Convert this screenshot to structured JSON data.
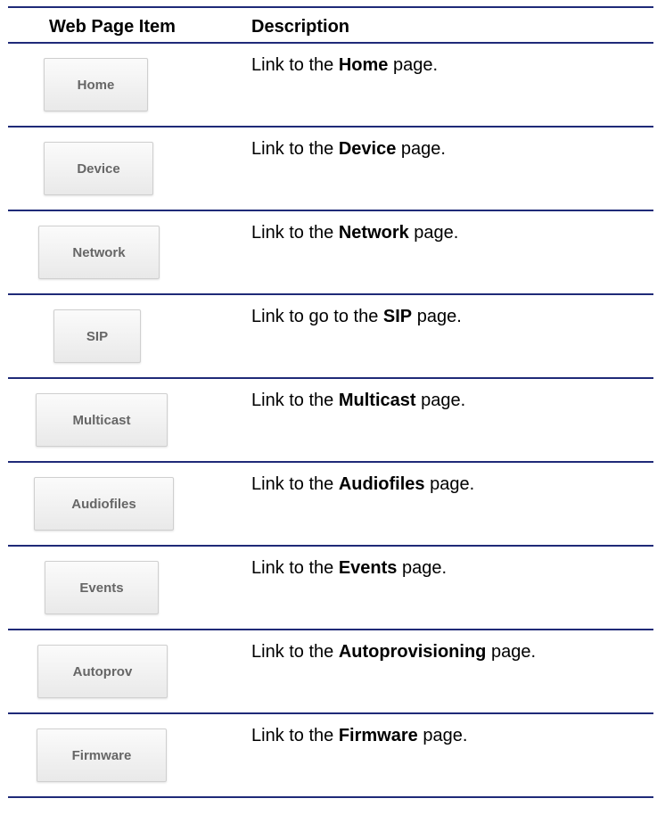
{
  "table": {
    "headers": {
      "item": "Web Page Item",
      "description": "Description"
    },
    "rows": [
      {
        "button": "Home",
        "prefix": "Link to the ",
        "bold": "Home",
        "suffix": " page."
      },
      {
        "button": "Device",
        "prefix": "Link to the ",
        "bold": "Device",
        "suffix": " page."
      },
      {
        "button": "Network",
        "prefix": "Link to the ",
        "bold": "Network",
        "suffix": " page."
      },
      {
        "button": "SIP",
        "prefix": "Link to go to the ",
        "bold": "SIP",
        "suffix": " page."
      },
      {
        "button": "Multicast",
        "prefix": "Link to the ",
        "bold": "Multicast",
        "suffix": " page."
      },
      {
        "button": "Audiofiles",
        "prefix": "Link to the ",
        "bold": "Audiofiles",
        "suffix": " page."
      },
      {
        "button": "Events",
        "prefix": "Link to the ",
        "bold": "Events",
        "suffix": " page."
      },
      {
        "button": "Autoprov",
        "prefix": "Link to the ",
        "bold": "Autoprovisioning",
        "suffix": " page."
      },
      {
        "button": "Firmware",
        "prefix": "Link to the ",
        "bold": "Firmware",
        "suffix": " page."
      }
    ]
  },
  "colors": {
    "rule": "#1f2a78",
    "button_text": "#666666",
    "button_border": "#cfcfcf"
  }
}
